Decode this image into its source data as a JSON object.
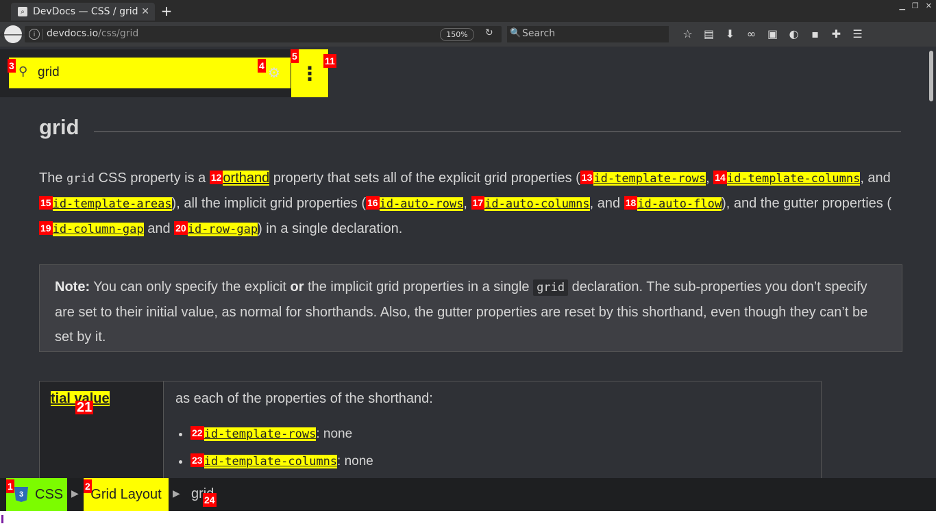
{
  "browser": {
    "tab_title": "DevDocs — CSS / grid",
    "url_host": "devdocs.io",
    "url_path": "/css/grid",
    "zoom": "150%",
    "search_placeholder": "Search"
  },
  "header": {
    "search_value": "grid"
  },
  "page": {
    "title": "grid",
    "intro": {
      "t1": "The ",
      "code1": "grid",
      "t2": " CSS property is a ",
      "link_shorthand": "orthand",
      "t3": " property that sets all of the explicit grid properties (",
      "l13": "id-template-rows",
      "c1": ", ",
      "l14": "id-template-columns",
      "c2": ", and ",
      "l15": "id-template-areas",
      "t4": "), all the implicit grid properties (",
      "l16": "id-auto-rows",
      "c3": ", ",
      "l17": "id-auto-columns",
      "c4": ", and ",
      "l18": "id-auto-flow",
      "t5": "), and the gutter properties (",
      "l19": "id-column-gap",
      "c5": " and ",
      "l20": "id-row-gap",
      "t6": ") in a single declaration."
    },
    "note": {
      "label": "Note:",
      "t1": " You can only specify the explicit ",
      "or": "or",
      "t2": " the implicit grid properties in a single ",
      "code": "grid",
      "t3": " declaration. The sub-properties you don’t specify are set to their initial value, as normal for shorthands. Also, the gutter properties are reset by this shorthand, even though they can’t be set by it."
    },
    "table": {
      "header": "tial value",
      "desc": "as each of the properties of the shorthand:",
      "items": [
        {
          "link": "id-template-rows",
          "value": ": none"
        },
        {
          "link": "id-template-columns",
          "value": ": none"
        }
      ]
    }
  },
  "breadcrumbs": {
    "c1": "CSS",
    "c2": "Grid Layout",
    "c3": "grid"
  },
  "badges": [
    "1",
    "2",
    "3",
    "4",
    "5",
    "11",
    "12",
    "13",
    "14",
    "15",
    "16",
    "17",
    "18",
    "19",
    "20",
    "21",
    "22",
    "23",
    "24"
  ]
}
